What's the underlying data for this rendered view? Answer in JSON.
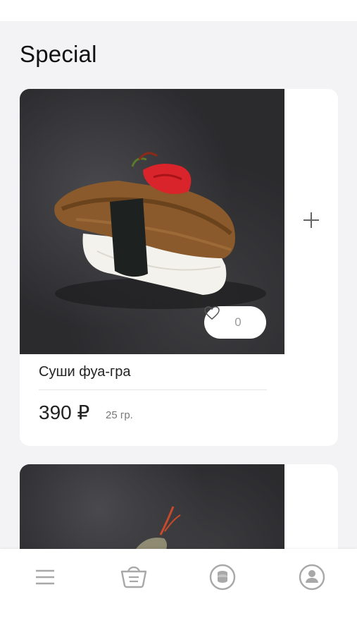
{
  "section": {
    "title": "Special"
  },
  "products": [
    {
      "name": "Суши фуа-гра",
      "price": "390 ₽",
      "weight": "25 гр.",
      "likes": "0"
    }
  ],
  "nav": {
    "items": [
      "menu-icon",
      "cart-icon",
      "coins-icon",
      "profile-icon"
    ]
  },
  "colors": {
    "background": "#f3f3f5",
    "card": "#ffffff",
    "icon_gray": "#a8a8a8",
    "plus_gray": "#666666"
  }
}
